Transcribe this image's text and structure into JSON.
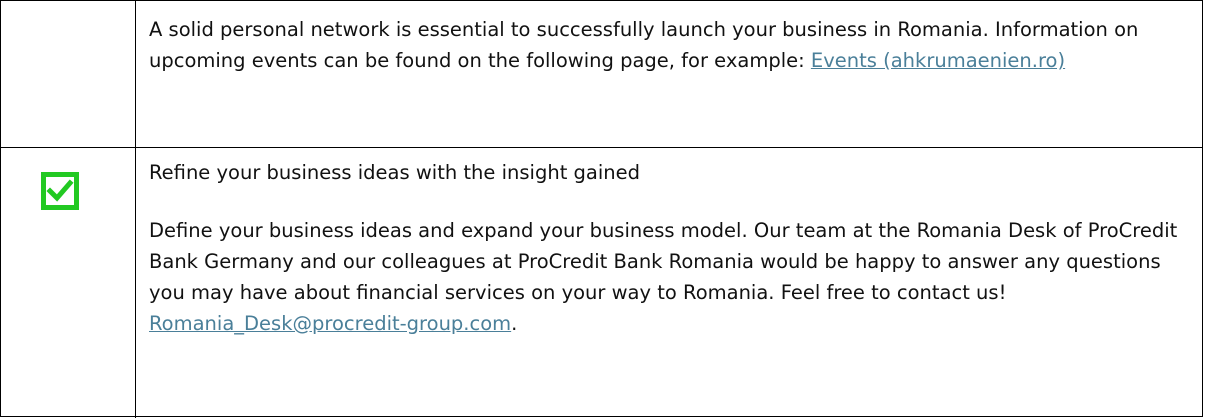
{
  "rows": [
    {
      "text_before_link": "A solid personal network is essential to successfully launch your business in Romania. Information on upcoming events can be found on the following page, for example: ",
      "link_text": "Events (ahkrumaenien.ro)"
    },
    {
      "checkbox_checked": true,
      "checkbox_color": "#22c922",
      "heading": "Refine your business ideas with the insight gained",
      "body_text": "Define your business ideas and expand your business model. Our team at the Romania Desk of ProCredit Bank Germany and our colleagues at ProCredit Bank Romania would be happy to answer any questions you may have about financial services on your way to Romania. Feel free to contact us! ",
      "email_link": "Romania_Desk@procredit-group.com",
      "after_link": "."
    }
  ],
  "colors": {
    "link": "#4a7f99",
    "border": "#000000",
    "text": "#111111"
  }
}
